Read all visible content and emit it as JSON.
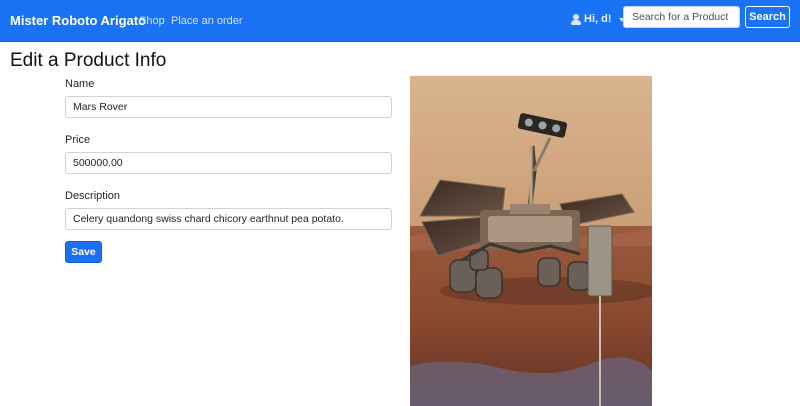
{
  "navbar": {
    "brand": "Mister Roboto Arigato",
    "links": [
      "Shop",
      "Place an order"
    ],
    "user_label": "Hi, d!",
    "search_placeholder": "Search for a Product",
    "search_button": "Search"
  },
  "page": {
    "title": "Edit a Product Info"
  },
  "form": {
    "name_label": "Name",
    "name_value": "Mars Rover",
    "price_label": "Price",
    "price_value": "500000.00",
    "description_label": "Description",
    "description_value": "Celery quandong swiss chard chicory earthnut pea potato.",
    "save_button": "Save"
  },
  "colors": {
    "navbar": "#1a73f5",
    "primary_button": "#1a6ff2"
  },
  "icons": [
    "user-icon",
    "caret-down-icon"
  ]
}
